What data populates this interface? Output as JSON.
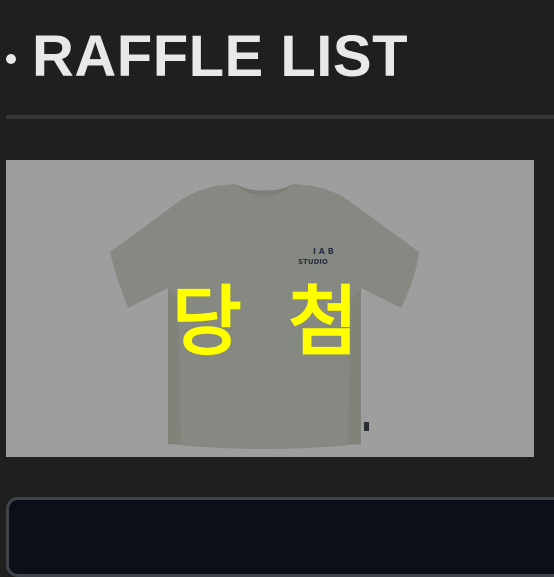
{
  "header": {
    "title": "RAFFLE LIST"
  },
  "raffle_item": {
    "status_label": "당 첨",
    "product_logo_line1": "I A B",
    "product_logo_line2": "STUDIO"
  },
  "colors": {
    "background": "#1f1f1f",
    "title": "#e8e8ea",
    "status_label": "#ffff00",
    "card_overlay": "#9e9e9e"
  }
}
